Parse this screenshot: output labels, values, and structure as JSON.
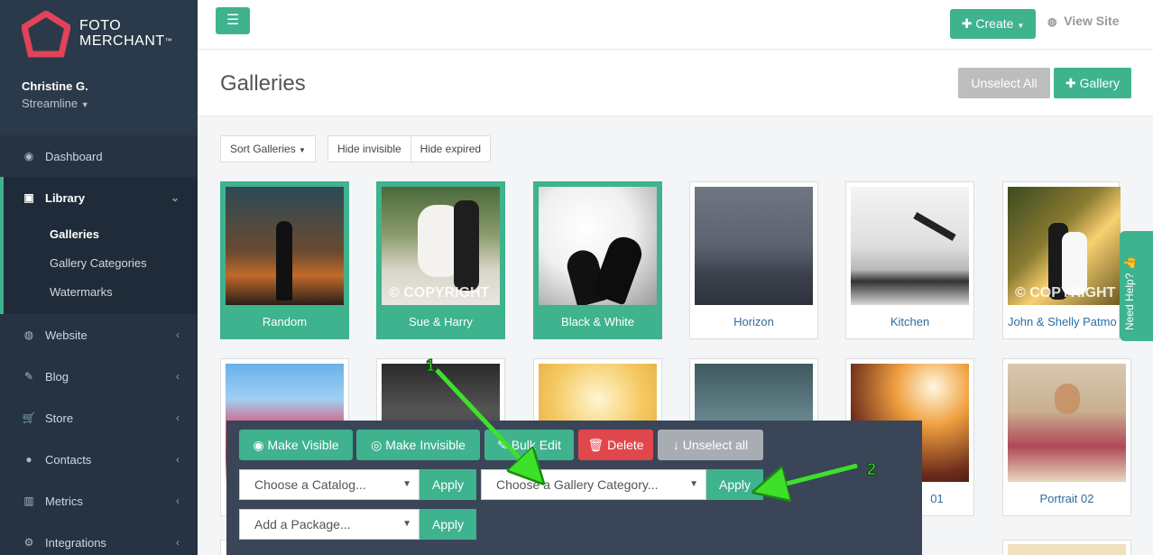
{
  "brand": {
    "line1": "FOTO",
    "line2": "MERCHANT",
    "tm": "™"
  },
  "user": {
    "name": "Christine G.",
    "plan": "Streamline"
  },
  "nav": {
    "dashboard": "Dashboard",
    "library": "Library",
    "library_sub": [
      "Galleries",
      "Gallery Categories",
      "Watermarks"
    ],
    "website": "Website",
    "blog": "Blog",
    "store": "Store",
    "contacts": "Contacts",
    "metrics": "Metrics",
    "integrations": "Integrations"
  },
  "topbar": {
    "create": "Create",
    "view_site": "View Site"
  },
  "header": {
    "title": "Galleries",
    "unselect_all": "Unselect All",
    "gallery": "Gallery"
  },
  "filters": {
    "sort": "Sort Galleries",
    "hide_invisible": "Hide invisible",
    "hide_expired": "Hide expired"
  },
  "galleries": [
    {
      "name": "Random",
      "selected": true
    },
    {
      "name": "Sue & Harry",
      "selected": true,
      "watermark": "© COPYRIGHT"
    },
    {
      "name": "Black & White",
      "selected": true
    },
    {
      "name": "Horizon",
      "selected": false
    },
    {
      "name": "Kitchen",
      "selected": false
    },
    {
      "name": "John & Shelly Patmo",
      "selected": false,
      "watermark": "© COPYRIGHT"
    },
    {
      "name": "",
      "selected": false
    },
    {
      "name": "",
      "selected": false
    },
    {
      "name": "",
      "selected": false
    },
    {
      "name": "",
      "selected": false
    },
    {
      "name": "01",
      "selected": false
    },
    {
      "name": "Portrait 02",
      "selected": false
    }
  ],
  "bulk": {
    "make_visible": "Make Visible",
    "make_invisible": "Make Invisible",
    "bulk_edit": "Bulk Edit",
    "delete": "Delete",
    "unselect_all": "Unselect all",
    "catalog_placeholder": "Choose a Catalog...",
    "category_placeholder": "Choose a Gallery Category...",
    "package_placeholder": "Add a Package...",
    "apply": "Apply"
  },
  "annotations": {
    "step1": "1",
    "step2": "2"
  },
  "help": {
    "label": "Need Help?"
  },
  "colors": {
    "accent": "#3fb28e",
    "sidebar": "#2b3a4a",
    "danger": "#e0474c",
    "arrow": "#3ee02a"
  }
}
